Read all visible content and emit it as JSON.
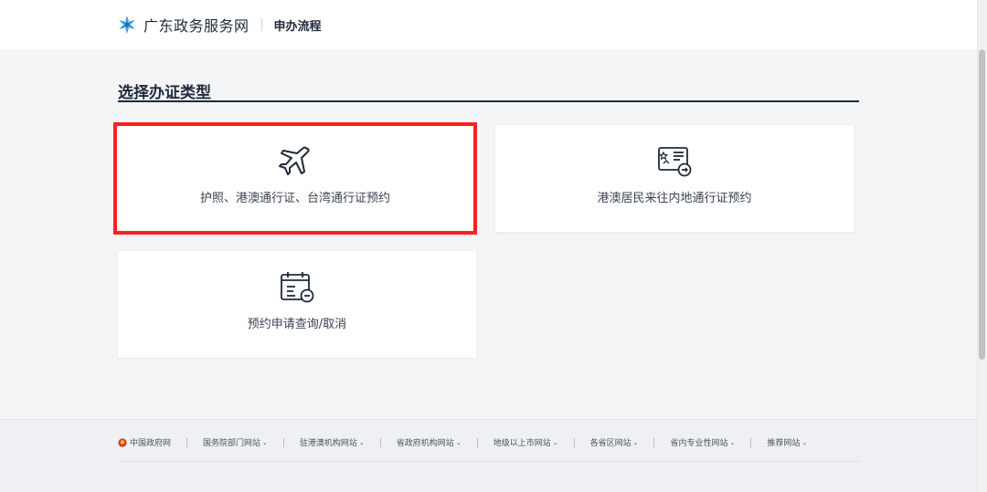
{
  "header": {
    "brand": "广东政务服务网",
    "subtitle": "申办流程",
    "logo_icon": "star-logo-icon"
  },
  "main": {
    "section_title": "选择办证类型",
    "cards": [
      {
        "label": "护照、港澳通行证、台湾通行证预约",
        "icon": "airplane-icon",
        "selected": true
      },
      {
        "label": "港澳居民来往内地通行证预约",
        "icon": "id-card-icon",
        "selected": false
      },
      {
        "label": "预约申请查询/取消",
        "icon": "calendar-icon",
        "selected": false
      }
    ]
  },
  "footer": {
    "links": [
      {
        "label": "中国政府网",
        "dropdown": false
      },
      {
        "label": "国务院部门网站",
        "dropdown": true
      },
      {
        "label": "驻港澳机构网站",
        "dropdown": true
      },
      {
        "label": "省政府机构网站",
        "dropdown": true
      },
      {
        "label": "地级以上市网站",
        "dropdown": true
      },
      {
        "label": "各省区网站",
        "dropdown": true
      },
      {
        "label": "省内专业性网站",
        "dropdown": true
      },
      {
        "label": "推荐网站",
        "dropdown": true
      }
    ]
  },
  "colors": {
    "selection_outline": "#ff1f1f",
    "title_rule": "#1e2a3a",
    "logo_blue": "#3aa0e0"
  }
}
